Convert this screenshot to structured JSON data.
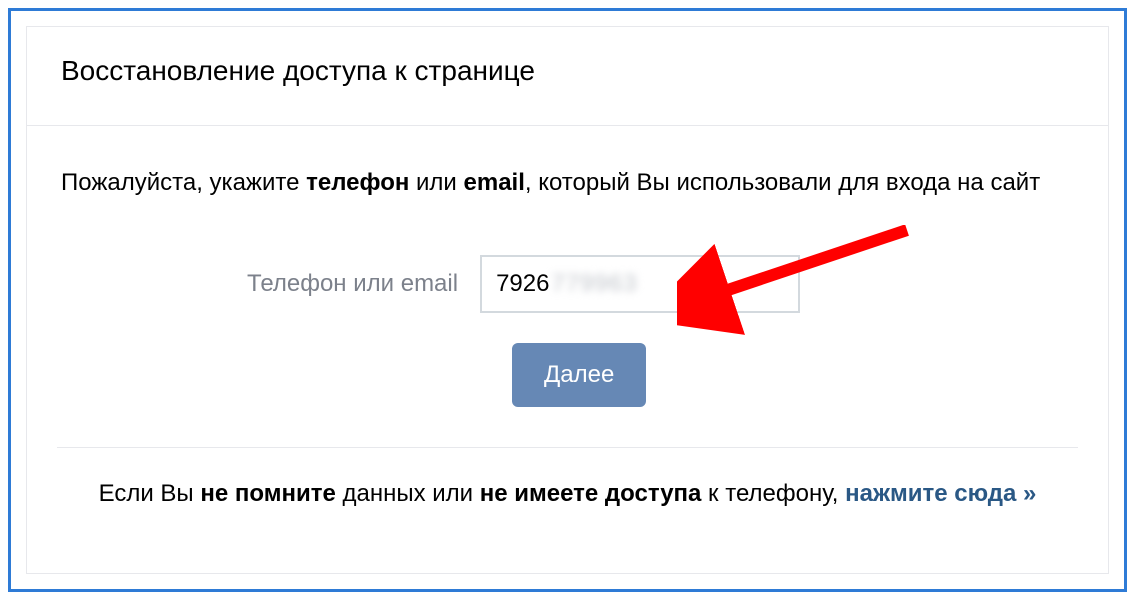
{
  "header": {
    "title": "Восстановление доступа к странице"
  },
  "body": {
    "instruction_parts": {
      "p1": "Пожалуйста, укажите ",
      "b1": "телефон",
      "p2": " или ",
      "b2": "email",
      "p3": ", который Вы использовали для входа на сайт"
    },
    "form": {
      "label": "Телефон или email",
      "input_value_visible": "7926",
      "input_value_blurred": "779963",
      "submit_label": "Далее"
    }
  },
  "footer": {
    "parts": {
      "p1": "Если Вы ",
      "b1": "не помните",
      "p2": " данных или ",
      "b2": "не имеете доступа",
      "p3": " к телефону, ",
      "link": "нажмите сюда »"
    }
  }
}
